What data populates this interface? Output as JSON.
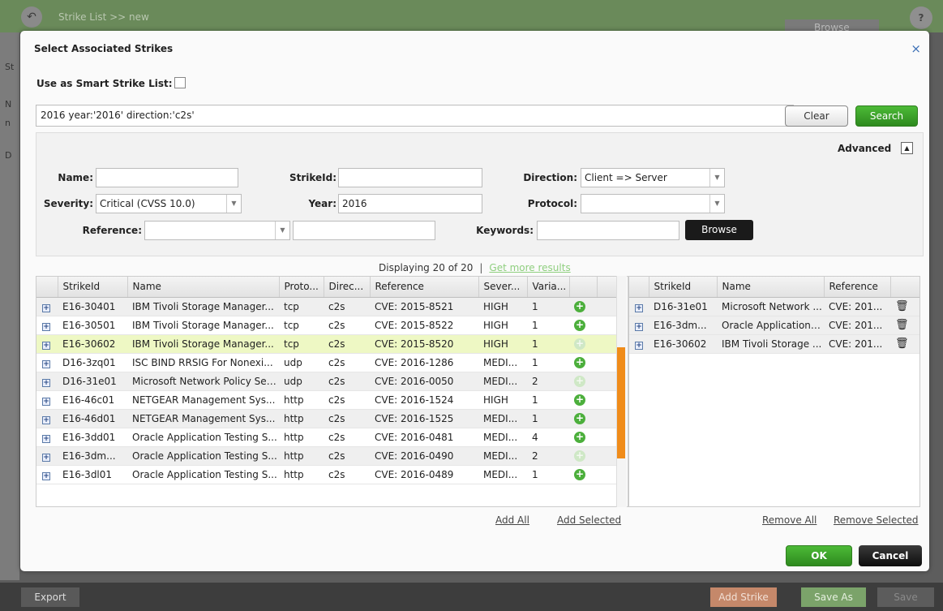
{
  "background": {
    "title": "Strike List >> new",
    "browse_label": "Browse",
    "help_label": "?",
    "left_letters": [
      "St",
      "N",
      "n",
      "D"
    ],
    "footer": {
      "export": "Export",
      "add_strike": "Add Strike",
      "save_as": "Save As",
      "save": "Save"
    }
  },
  "dialog": {
    "title": "Select Associated Strikes",
    "close": "×",
    "smart_label": "Use as Smart Strike List:",
    "query": "2016 year:'2016' direction:'c2s'",
    "clear": "Clear",
    "search": "Search",
    "advanced": {
      "label": "Advanced",
      "name_label": "Name:",
      "strikeid_label": "StrikeId:",
      "direction_label": "Direction:",
      "direction_value": "Client => Server",
      "severity_label": "Severity:",
      "severity_value": "Critical (CVSS 10.0)",
      "year_label": "Year:",
      "year_value": "2016",
      "protocol_label": "Protocol:",
      "reference_label": "Reference:",
      "keywords_label": "Keywords:",
      "browse": "Browse"
    },
    "status": {
      "displaying": "Displaying 20 of 20",
      "sep": "|",
      "more": "Get more results"
    },
    "left_table": {
      "headers": [
        "StrikeId",
        "Name",
        "Proto...",
        "Direc...",
        "Reference",
        "Sever...",
        "Varia..."
      ],
      "rows": [
        {
          "id": "E16-30401",
          "name": "IBM Tivoli Storage Manager...",
          "proto": "tcp",
          "dir": "c2s",
          "ref": "CVE: 2015-8521",
          "sev": "HIGH",
          "var": "1",
          "added": false
        },
        {
          "id": "E16-30501",
          "name": "IBM Tivoli Storage Manager...",
          "proto": "tcp",
          "dir": "c2s",
          "ref": "CVE: 2015-8522",
          "sev": "HIGH",
          "var": "1",
          "added": false
        },
        {
          "id": "E16-30602",
          "name": "IBM Tivoli Storage Manager...",
          "proto": "tcp",
          "dir": "c2s",
          "ref": "CVE: 2015-8520",
          "sev": "HIGH",
          "var": "1",
          "added": true
        },
        {
          "id": "D16-3zq01",
          "name": "ISC BIND RRSIG For Nonexi...",
          "proto": "udp",
          "dir": "c2s",
          "ref": "CVE: 2016-1286",
          "sev": "MEDI...",
          "var": "1",
          "added": false
        },
        {
          "id": "D16-31e01",
          "name": "Microsoft Network Policy Ser...",
          "proto": "udp",
          "dir": "c2s",
          "ref": "CVE: 2016-0050",
          "sev": "MEDI...",
          "var": "2",
          "added": true
        },
        {
          "id": "E16-46c01",
          "name": "NETGEAR Management Sys...",
          "proto": "http",
          "dir": "c2s",
          "ref": "CVE: 2016-1524",
          "sev": "HIGH",
          "var": "1",
          "added": false
        },
        {
          "id": "E16-46d01",
          "name": "NETGEAR Management Sys...",
          "proto": "http",
          "dir": "c2s",
          "ref": "CVE: 2016-1525",
          "sev": "MEDI...",
          "var": "1",
          "added": false
        },
        {
          "id": "E16-3dd01",
          "name": "Oracle Application Testing S...",
          "proto": "http",
          "dir": "c2s",
          "ref": "CVE: 2016-0481",
          "sev": "MEDI...",
          "var": "4",
          "added": false
        },
        {
          "id": "E16-3dm...",
          "name": "Oracle Application Testing S...",
          "proto": "http",
          "dir": "c2s",
          "ref": "CVE: 2016-0490",
          "sev": "MEDI...",
          "var": "2",
          "added": true
        },
        {
          "id": "E16-3dl01",
          "name": "Oracle Application Testing S...",
          "proto": "http",
          "dir": "c2s",
          "ref": "CVE: 2016-0489",
          "sev": "MEDI...",
          "var": "1",
          "added": false
        }
      ]
    },
    "right_table": {
      "headers": [
        "StrikeId",
        "Name",
        "Reference"
      ],
      "rows": [
        {
          "id": "D16-31e01",
          "name": "Microsoft Network ...",
          "ref": "CVE: 201..."
        },
        {
          "id": "E16-3dm...",
          "name": "Oracle Application ...",
          "ref": "CVE: 201..."
        },
        {
          "id": "E16-30602",
          "name": "IBM Tivoli Storage ...",
          "ref": "CVE: 201..."
        }
      ]
    },
    "add_all": "Add All",
    "add_selected": "Add Selected",
    "remove_all": "Remove All",
    "remove_selected": "Remove Selected",
    "ok": "OK",
    "cancel": "Cancel"
  }
}
